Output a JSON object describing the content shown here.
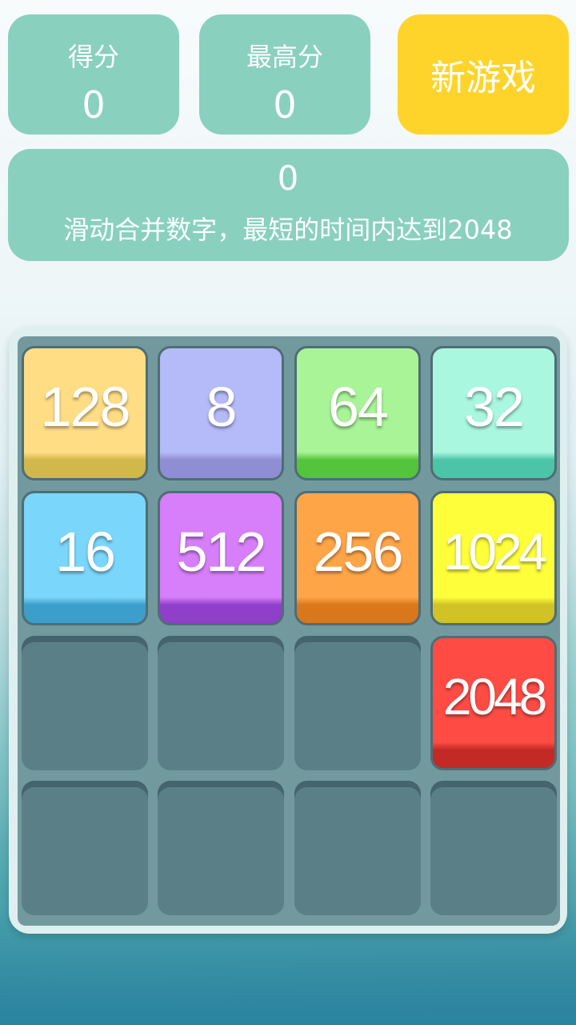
{
  "header": {
    "score_label": "得分",
    "score_value": "0",
    "best_label": "最高分",
    "best_value": "0",
    "new_game_label": "新游戏"
  },
  "info": {
    "timer": "0",
    "hint": "滑动合并数字，最短的时间内达到2048"
  },
  "board": {
    "rows": [
      [
        {
          "value": "128",
          "color": "#ffdd85",
          "edge": "#d1b84a"
        },
        {
          "value": "8",
          "color": "#b5baf8",
          "edge": "#8f8ed4"
        },
        {
          "value": "64",
          "color": "#a8f497",
          "edge": "#55c43d"
        },
        {
          "value": "32",
          "color": "#a9f7de",
          "edge": "#4bc4a8"
        }
      ],
      [
        {
          "value": "16",
          "color": "#7bd6fb",
          "edge": "#3c9fcb"
        },
        {
          "value": "512",
          "color": "#d77ffa",
          "edge": "#8f3fc9"
        },
        {
          "value": "256",
          "color": "#fea548",
          "edge": "#d9771a"
        },
        {
          "value": "1024",
          "color": "#fffe3a",
          "edge": "#d1c227"
        }
      ],
      [
        null,
        null,
        null,
        {
          "value": "2048",
          "color": "#fe4c45",
          "edge": "#c32a25"
        }
      ],
      [
        null,
        null,
        null,
        null
      ]
    ]
  }
}
